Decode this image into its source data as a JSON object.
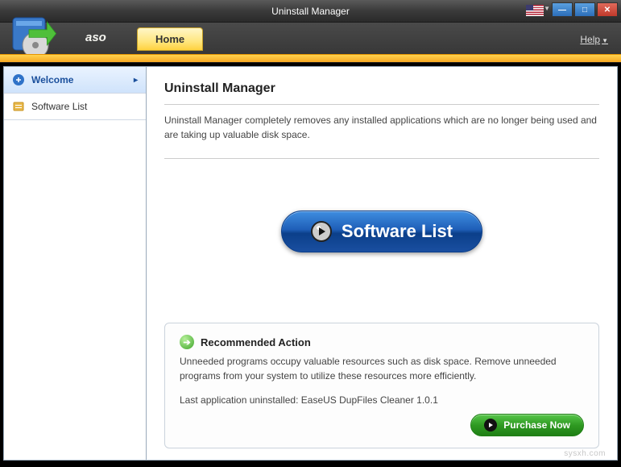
{
  "window": {
    "title": "Uninstall Manager"
  },
  "help_label": "Help",
  "ribbon": {
    "brand": "aso",
    "tabs": [
      {
        "label": "Home"
      }
    ]
  },
  "sidebar": {
    "items": [
      {
        "label": "Welcome",
        "active": true
      },
      {
        "label": "Software List",
        "active": false
      }
    ]
  },
  "main": {
    "heading": "Uninstall Manager",
    "description": "Uninstall Manager completely removes any installed applications which are no longer being used and are taking up valuable disk space.",
    "hero_button": "Software List"
  },
  "recommended": {
    "title": "Recommended Action",
    "body": "Unneeded programs occupy valuable resources such as disk space. Remove unneeded programs from your system to utilize these resources more efficiently.",
    "last_label": "Last application uninstalled:",
    "last_value": "EaseUS DupFiles Cleaner 1.0.1",
    "purchase": "Purchase Now"
  },
  "watermark": "sysxh.com"
}
